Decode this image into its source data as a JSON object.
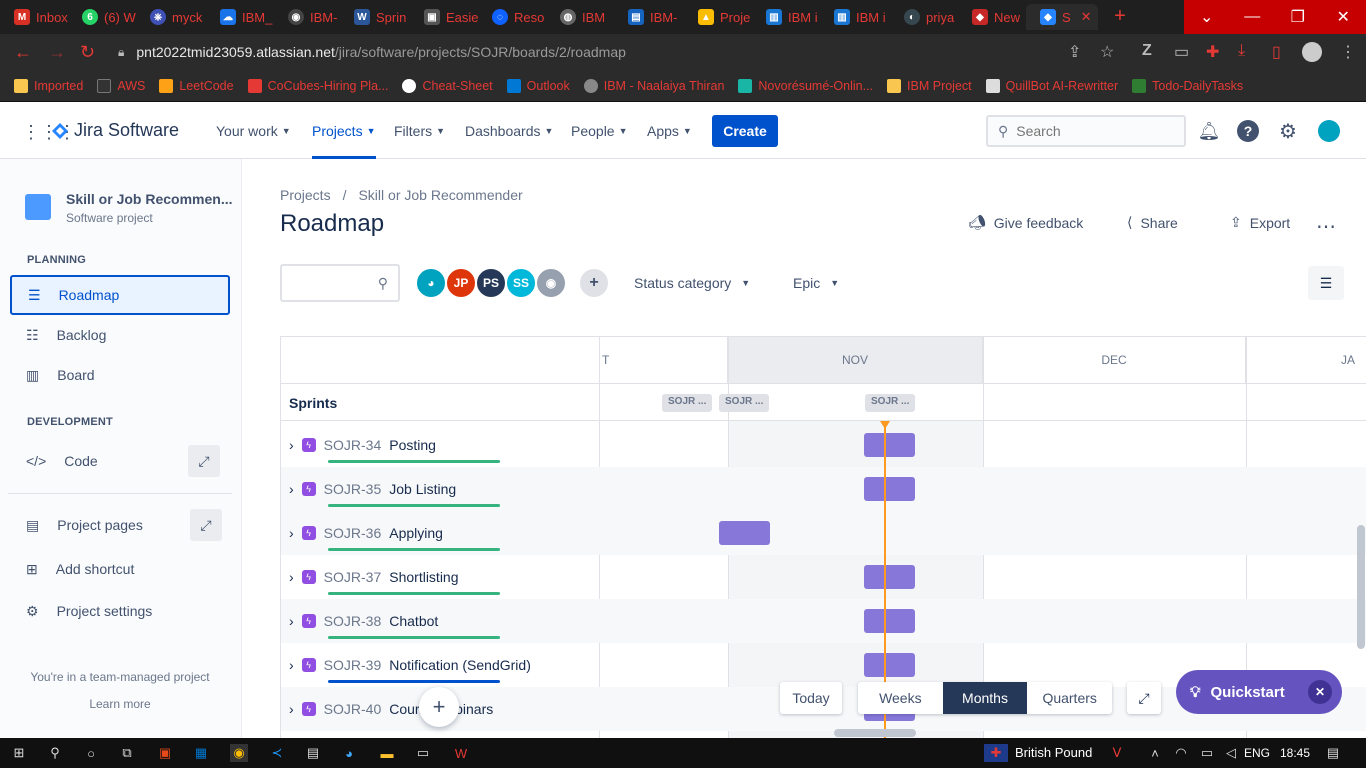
{
  "browser": {
    "tabs": [
      {
        "label": "Inbox",
        "color": "#d93025",
        "glyph": "M"
      },
      {
        "label": "(6) W",
        "color": "#25d366",
        "glyph": "6"
      },
      {
        "label": "myck",
        "color": "#3f51b5",
        "glyph": "⎈"
      },
      {
        "label": "IBM_",
        "color": "#1a73e8",
        "glyph": "☁"
      },
      {
        "label": "IBM-",
        "color": "#444",
        "glyph": "◉"
      },
      {
        "label": "Sprin",
        "color": "#2b579a",
        "glyph": "W"
      },
      {
        "label": "Easie",
        "color": "#555",
        "glyph": "▣"
      },
      {
        "label": "Reso",
        "color": "#0f62fe",
        "glyph": "◌"
      },
      {
        "label": "IBM",
        "color": "#666",
        "glyph": "◍"
      },
      {
        "label": "IBM-",
        "color": "#1565c0",
        "glyph": "▤"
      },
      {
        "label": "Proje",
        "color": "#fbbc04",
        "glyph": "▲"
      },
      {
        "label": "IBM i",
        "color": "#1976d2",
        "glyph": "▥"
      },
      {
        "label": "IBM i",
        "color": "#1976d2",
        "glyph": "▥"
      },
      {
        "label": "priya",
        "color": "#37474f",
        "glyph": "◐"
      },
      {
        "label": "New",
        "color": "#c62828",
        "glyph": "◆"
      },
      {
        "label": "S",
        "color": "#2684ff",
        "glyph": "◆"
      }
    ],
    "url_host": "pnt2022tmid23059.atlassian.net",
    "url_path": "/jira/software/projects/SOJR/boards/2/roadmap",
    "bookmarks": [
      {
        "label": "Imported",
        "color": "#f9c74f"
      },
      {
        "label": "AWS",
        "color": "#333"
      },
      {
        "label": "LeetCode",
        "color": "#ffa116"
      },
      {
        "label": "CoCubes-Hiring Pla...",
        "color": "#e53935"
      },
      {
        "label": "Cheat-Sheet",
        "color": "#fff"
      },
      {
        "label": "Outlook",
        "color": "#0078d4"
      },
      {
        "label": "IBM - Naalaiya Thiran",
        "color": "#888"
      },
      {
        "label": "Novorésumé-Onlin...",
        "color": "#19b5a5"
      },
      {
        "label": "IBM Project",
        "color": "#f9c74f"
      },
      {
        "label": "QuillBot AI-Rewritter",
        "color": "#ddd"
      },
      {
        "label": "Todo-DailyTasks",
        "color": "#2e7d32"
      }
    ]
  },
  "jira": {
    "product": "Jira Software",
    "nav": [
      "Your work",
      "Projects",
      "Filters",
      "Dashboards",
      "People",
      "Apps"
    ],
    "create_label": "Create",
    "search_placeholder": "Search"
  },
  "sidebar": {
    "project_name": "Skill or Job Recommen...",
    "project_type": "Software project",
    "planning_heading": "PLANNING",
    "planning_items": [
      "Roadmap",
      "Backlog",
      "Board"
    ],
    "development_heading": "DEVELOPMENT",
    "code_label": "Code",
    "project_pages": "Project pages",
    "add_shortcut": "Add shortcut",
    "project_settings": "Project settings",
    "team_note": "You're in a team-managed project",
    "learn_more": "Learn more"
  },
  "main": {
    "breadcrumb": [
      "Projects",
      "Skill or Job Recommender"
    ],
    "title": "Roadmap",
    "give_feedback": "Give feedback",
    "share": "Share",
    "export": "Export",
    "avatars": [
      {
        "initials": "",
        "color": "#00a3bf"
      },
      {
        "initials": "JP",
        "color": "#de350b"
      },
      {
        "initials": "PS",
        "color": "#253858"
      },
      {
        "initials": "SS",
        "color": "#00b8d9"
      },
      {
        "initials": "",
        "color": "#97a0af"
      }
    ],
    "status_category": "Status category",
    "epic_filter": "Epic"
  },
  "roadmap": {
    "months": [
      "T",
      "NOV",
      "DEC",
      "JA"
    ],
    "sprints_label": "Sprints",
    "sprint_chips": [
      "SOJR ...",
      "SOJR ...",
      "SOJR ..."
    ],
    "epics": [
      {
        "key": "SOJR-34",
        "summary": "Posting"
      },
      {
        "key": "SOJR-35",
        "summary": "Job Listing"
      },
      {
        "key": "SOJR-36",
        "summary": "Applying"
      },
      {
        "key": "SOJR-37",
        "summary": "Shortlisting"
      },
      {
        "key": "SOJR-38",
        "summary": "Chatbot"
      },
      {
        "key": "SOJR-39",
        "summary": "Notification (SendGrid)"
      },
      {
        "key": "SOJR-40",
        "summary": "Cour... Webinars"
      }
    ],
    "today_label": "Today",
    "views": [
      "Weeks",
      "Months",
      "Quarters"
    ],
    "active_view": "Months",
    "quickstart": "Quickstart"
  },
  "taskbar": {
    "currency": "British Pound",
    "lang": "ENG",
    "time": "18:45"
  }
}
